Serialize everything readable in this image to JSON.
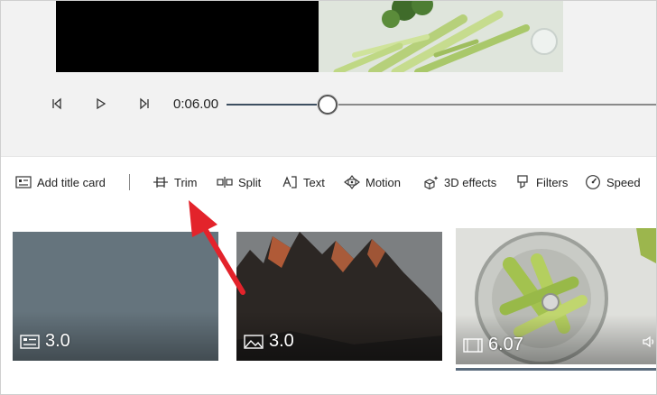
{
  "playback": {
    "time": "0:06.00",
    "progress_percent": 23.5
  },
  "toolbar": {
    "add_title_card": "Add title card",
    "trim": "Trim",
    "split": "Split",
    "text": "Text",
    "motion": "Motion",
    "effects_3d": "3D effects",
    "filters": "Filters",
    "speed": "Speed"
  },
  "storyboard": {
    "cards": [
      {
        "kind": "title-card",
        "duration": "3.0",
        "icon": "title-card-icon",
        "color": "#65747d"
      },
      {
        "kind": "image",
        "duration": "3.0",
        "icon": "image-icon"
      },
      {
        "kind": "video",
        "duration": "6.07",
        "icon": "video-icon",
        "selected": true
      }
    ]
  },
  "colors": {
    "accent": "#3d4f61",
    "annotation_arrow": "#e3232b"
  }
}
